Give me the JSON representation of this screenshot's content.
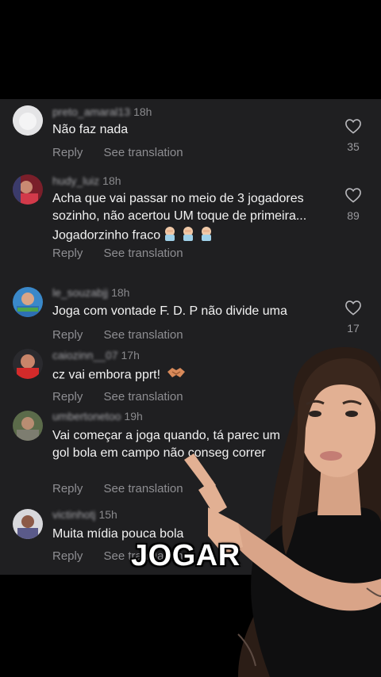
{
  "comments": [
    {
      "username": "preto_amaral13",
      "time": "18h",
      "text": "Não faz nada",
      "reply": "Reply",
      "translate": "See translation",
      "likes": "35"
    },
    {
      "username": "hudy_luiz",
      "time": "18h",
      "text": "Acha que vai passar no meio de 3 jogadores sozinho, não acertou UM toque de primeira... Jogadorzinho fraco",
      "reply": "Reply",
      "translate": "See translation",
      "likes": "89"
    },
    {
      "username": "le_souzabjj",
      "time": "18h",
      "text": "Joga com vontade F.  D.  P não divide uma",
      "reply": "Reply",
      "translate": "See translation",
      "likes": "17"
    },
    {
      "username": "caiozinn__07",
      "time": "17h",
      "text": "cz vai embora pprt!",
      "reply": "Reply",
      "translate": "See translation"
    },
    {
      "username": "umbertonetoo",
      "time": "19h",
      "text": "Vai começar a joga quando, tá parec um gol bola em campo não conseg correr",
      "reply": "Reply",
      "translate": "See translation"
    },
    {
      "username": "victinhotj",
      "time": "15h",
      "text": "Muita mídia pouca bola",
      "reply": "Reply",
      "translate": "See translation"
    }
  ],
  "caption": "JOGAR",
  "colors": {
    "panel": "#1f1f21",
    "muted": "#8e8e92",
    "text": "#f2f2f2"
  },
  "icons": [
    "heart-outline-icon",
    "facepalm-emoji-icon",
    "handshake-emoji-icon"
  ]
}
